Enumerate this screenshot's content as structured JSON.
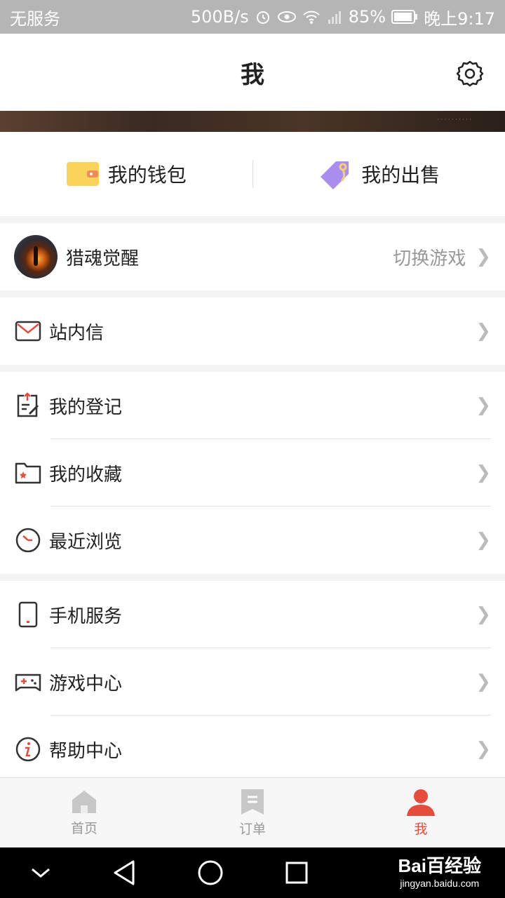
{
  "status_bar": {
    "carrier": "无服务",
    "speed": "500B/s",
    "battery": "85%",
    "time": "晚上9:17"
  },
  "header": {
    "title": "我"
  },
  "wallet_row": {
    "wallet_label": "我的钱包",
    "sale_label": "我的出售"
  },
  "game": {
    "name": "猎魂觉醒",
    "switch_label": "切换游戏"
  },
  "menu": {
    "messages": "站内信",
    "registrations": "我的登记",
    "favorites": "我的收藏",
    "recent": "最近浏览",
    "phone_service": "手机服务",
    "game_center": "游戏中心",
    "help_center": "帮助中心"
  },
  "tabbar": {
    "home": "首页",
    "orders": "订单",
    "me": "我"
  },
  "colors": {
    "accent": "#e54c3c",
    "wallet_yellow": "#f9d35a",
    "tag_purple": "#a98ef0"
  },
  "watermark": {
    "top": "Bai百经验",
    "bottom": "jingyan.baidu.com"
  }
}
